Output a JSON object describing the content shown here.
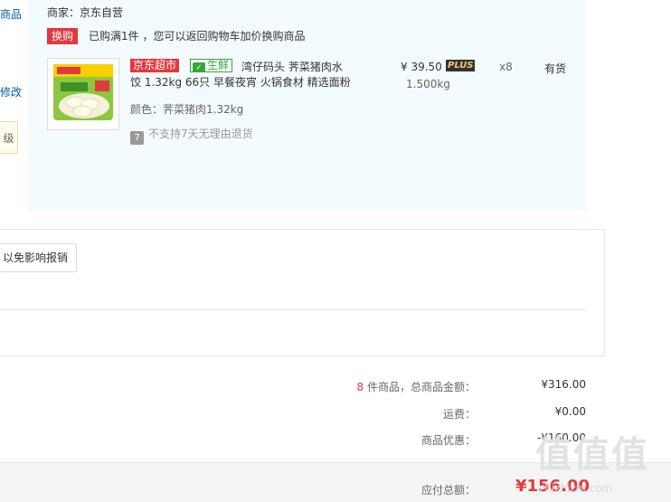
{
  "left": {
    "frag1": "商品",
    "frag2": "修改",
    "tip": "级"
  },
  "order": {
    "merchant": "商家：京东自营",
    "swap_tag": "换购",
    "swap_text": "已购满1件 ，您可以返回购物车加价换购商品",
    "item": {
      "tag_jd": "京东超市",
      "tag_fresh": "生鲜",
      "title_line1": "湾仔码头 荠菜猪肉水",
      "title_line2": "饺 1.32kg 66只 早餐夜宵 火锅食材 精选面粉",
      "color": "颜色：荠菜猪肉1.32kg",
      "return_policy": "不支持7天无理由退货",
      "return_icon_text": "7",
      "price": "¥ 39.50",
      "plus": "PLUS",
      "weight": "1.500kg",
      "qty": "x8",
      "stock": "有货"
    }
  },
  "invoice": {
    "button_label": "以免影响报销"
  },
  "summary": {
    "count": "8",
    "total_label": " 件商品，总商品金额：",
    "total_value": "¥316.00",
    "shipping_label": "运费：",
    "shipping_value": "¥0.00",
    "discount_label": "商品优惠：",
    "discount_value": "-¥160.00",
    "payable_label": "应付总额：",
    "payable_value": "¥156.00"
  },
  "watermark": {
    "logo": "值值值",
    "url": "zhizhizhi.com"
  },
  "colors": {
    "accent_red": "#e4393c",
    "fresh_green": "#3aa63a",
    "block_bg": "#f3fbfe",
    "link_blue": "#005ea7"
  }
}
